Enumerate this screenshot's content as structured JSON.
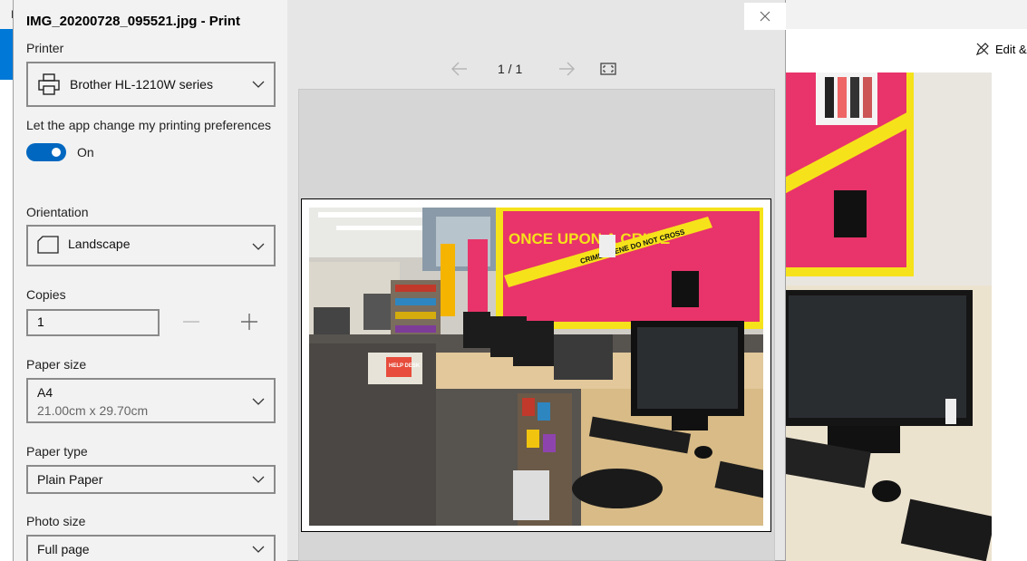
{
  "background_app": {
    "title_letter": "P",
    "edit_label": "Edit &",
    "icons": {
      "edit": "edit-pen-icon"
    }
  },
  "dialog": {
    "title": "IMG_20200728_095521.jpg - Print",
    "close_icon": "close-icon",
    "printer": {
      "label": "Printer",
      "value": "Brother HL-1210W series",
      "icon": "printer-icon"
    },
    "preferences": {
      "label": "Let the app change my printing preferences",
      "toggle_state": "On",
      "toggle_on": true
    },
    "orientation": {
      "label": "Orientation",
      "value": "Landscape",
      "icon": "page-orientation-icon"
    },
    "copies": {
      "label": "Copies",
      "value": "1"
    },
    "paper_size": {
      "label": "Paper size",
      "value": "A4",
      "detail": "21.00cm x 29.70cm"
    },
    "paper_type": {
      "label": "Paper type",
      "value": "Plain Paper"
    },
    "photo_size": {
      "label": "Photo size",
      "value": "Full page"
    }
  },
  "preview": {
    "page_indicator": "1 / 1",
    "icons": {
      "prev": "arrow-left-icon",
      "next": "arrow-right-icon",
      "fit": "fit-page-icon"
    },
    "photo_signs": {
      "banner": "ONCE UPON A CRIME",
      "tape": "CRIME SCENE DO NOT CROSS",
      "desk_sign": "HELP DESK"
    }
  },
  "colors": {
    "accent": "#0067c0",
    "dialog_bg": "#f2f2f2",
    "preview_bg": "#d6d6d6",
    "banner_pink": "#e8346a",
    "banner_yellow": "#f6e21a"
  }
}
